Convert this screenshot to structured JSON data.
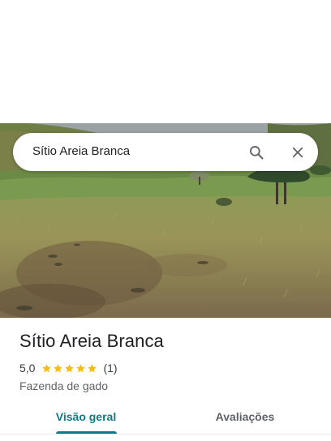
{
  "search": {
    "query": "Sítio Areia Branca"
  },
  "place": {
    "title": "Sítio Areia Branca",
    "rating_value": "5,0",
    "stars": 5,
    "review_count": "(1)",
    "category": "Fazenda de gado"
  },
  "tabs": [
    {
      "label": "Visão geral",
      "active": true
    },
    {
      "label": "Avaliações",
      "active": false
    }
  ],
  "colors": {
    "accent": "#0b7c84",
    "star": "#fbbc04"
  },
  "icons": {
    "search": "search-icon",
    "close": "close-icon",
    "star": "star-icon"
  }
}
